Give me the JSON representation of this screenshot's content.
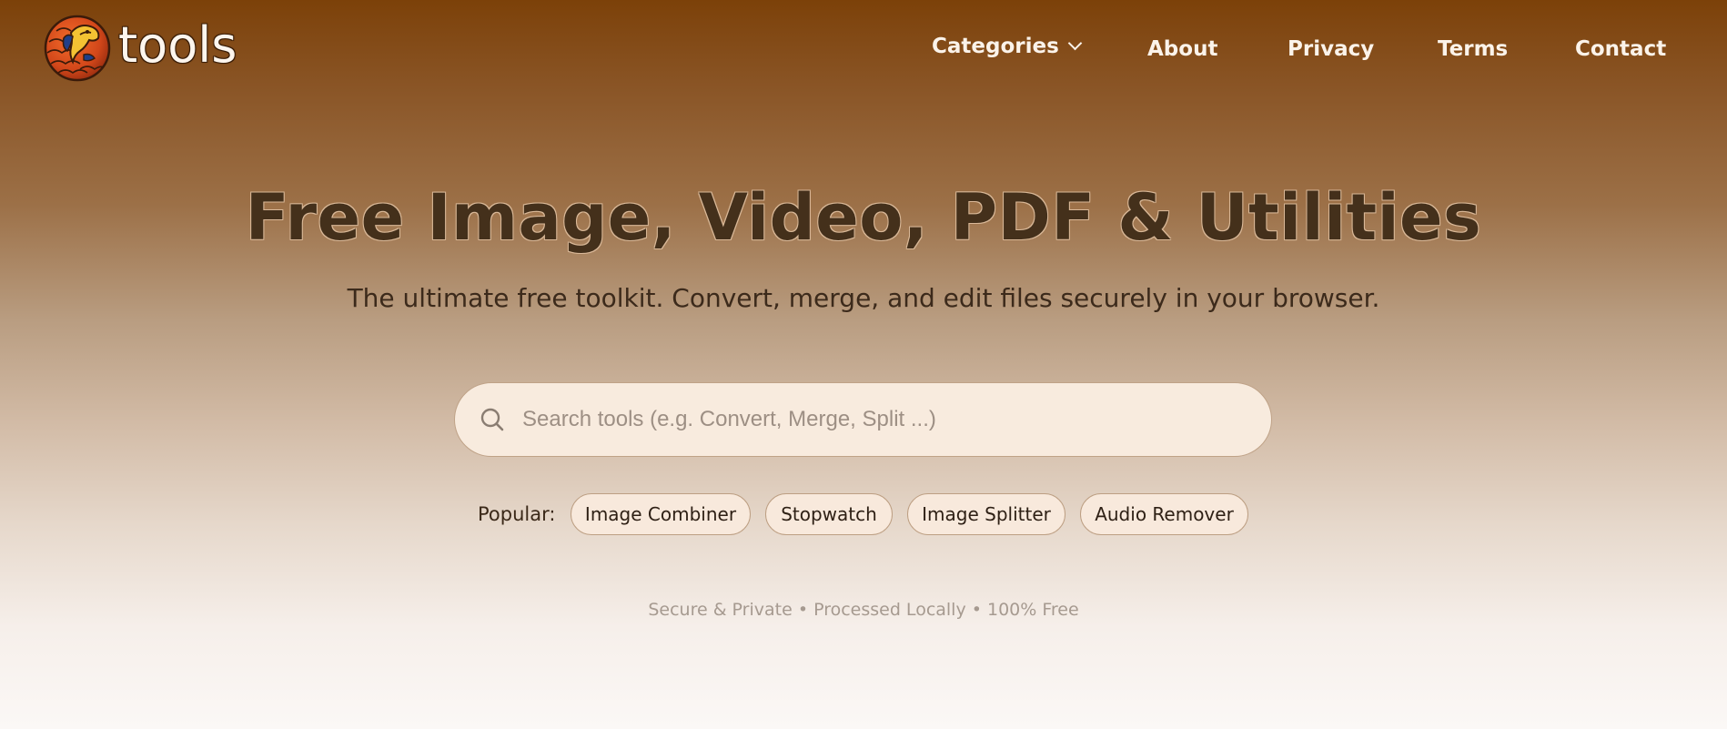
{
  "brand": {
    "name": "tools",
    "logo_icon": "pangolin-logo-icon"
  },
  "nav": {
    "categories": "Categories",
    "categories_icon": "chevron-down-icon",
    "about": "About",
    "privacy": "Privacy",
    "terms": "Terms",
    "contact": "Contact"
  },
  "hero": {
    "title": "Free Image, Video, PDF & Utilities",
    "subtitle": "The ultimate free toolkit. Convert, merge, and edit files securely in your browser."
  },
  "search": {
    "icon": "search-icon",
    "placeholder": "Search tools (e.g. Convert, Merge, Split ...)",
    "value": ""
  },
  "popular": {
    "label": "Popular:",
    "items": [
      "Image Combiner",
      "Stopwatch",
      "Image Splitter",
      "Audio Remover"
    ]
  },
  "trust_note": "Secure & Private • Processed Locally • 100% Free",
  "colors": {
    "header_brown": "#7c4109",
    "title_text": "#44301b",
    "chip_bg": "#f8e9dc",
    "search_bg": "#f8ebde",
    "page_bottom": "#fbf8f6"
  }
}
